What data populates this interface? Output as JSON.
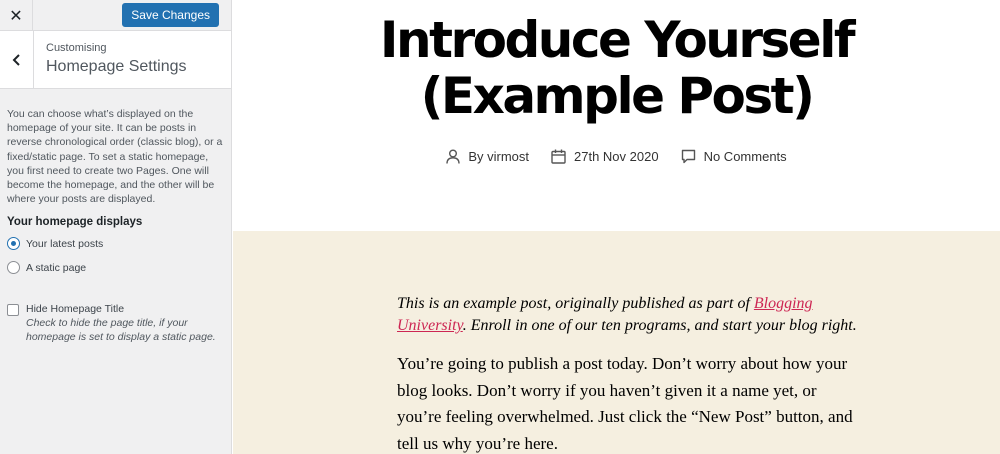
{
  "topbar": {
    "close_glyph": "✕",
    "save_label": "Save Changes"
  },
  "section": {
    "subtitle": "Customising",
    "title": "Homepage Settings"
  },
  "panel": {
    "description": "You can choose what’s displayed on the homepage of your site. It can be posts in reverse chronological order (classic blog), or a fixed/static page. To set a static homepage, you first need to create two Pages. One will become the homepage, and the other will be where your posts are displayed.",
    "group_label": "Your homepage displays",
    "radio_options": [
      {
        "label": "Your latest posts",
        "selected": true
      },
      {
        "label": "A static page",
        "selected": false
      }
    ],
    "hide_title": {
      "label": "Hide Homepage Title",
      "checked": false,
      "description": "Check to hide the page title, if your homepage is set to display a static page."
    }
  },
  "preview": {
    "title_line1": "Introduce Yourself",
    "title_line2": "(Example Post)",
    "meta": {
      "author": "By virmost",
      "date": "27th Nov 2020",
      "comments": "No Comments"
    },
    "intro": {
      "before_link": "This is an example post, originally published as part of ",
      "link_text": "Blogging University",
      "after_link": ". Enroll in one of our ten programs, and start your blog right."
    },
    "paragraph": "You’re going to publish a post today. Don’t worry about how your blog looks. Don’t worry if you haven’t given it a name yet, or you’re feeling overwhelmed. Just click the “New Post” button, and tell us why you’re here."
  },
  "colors": {
    "accent": "#2271b1",
    "link": "#cd2653",
    "content_background": "#f5efe0"
  },
  "icons": [
    "close-icon",
    "back-chevron-icon",
    "user-icon",
    "calendar-icon",
    "comment-icon"
  ]
}
